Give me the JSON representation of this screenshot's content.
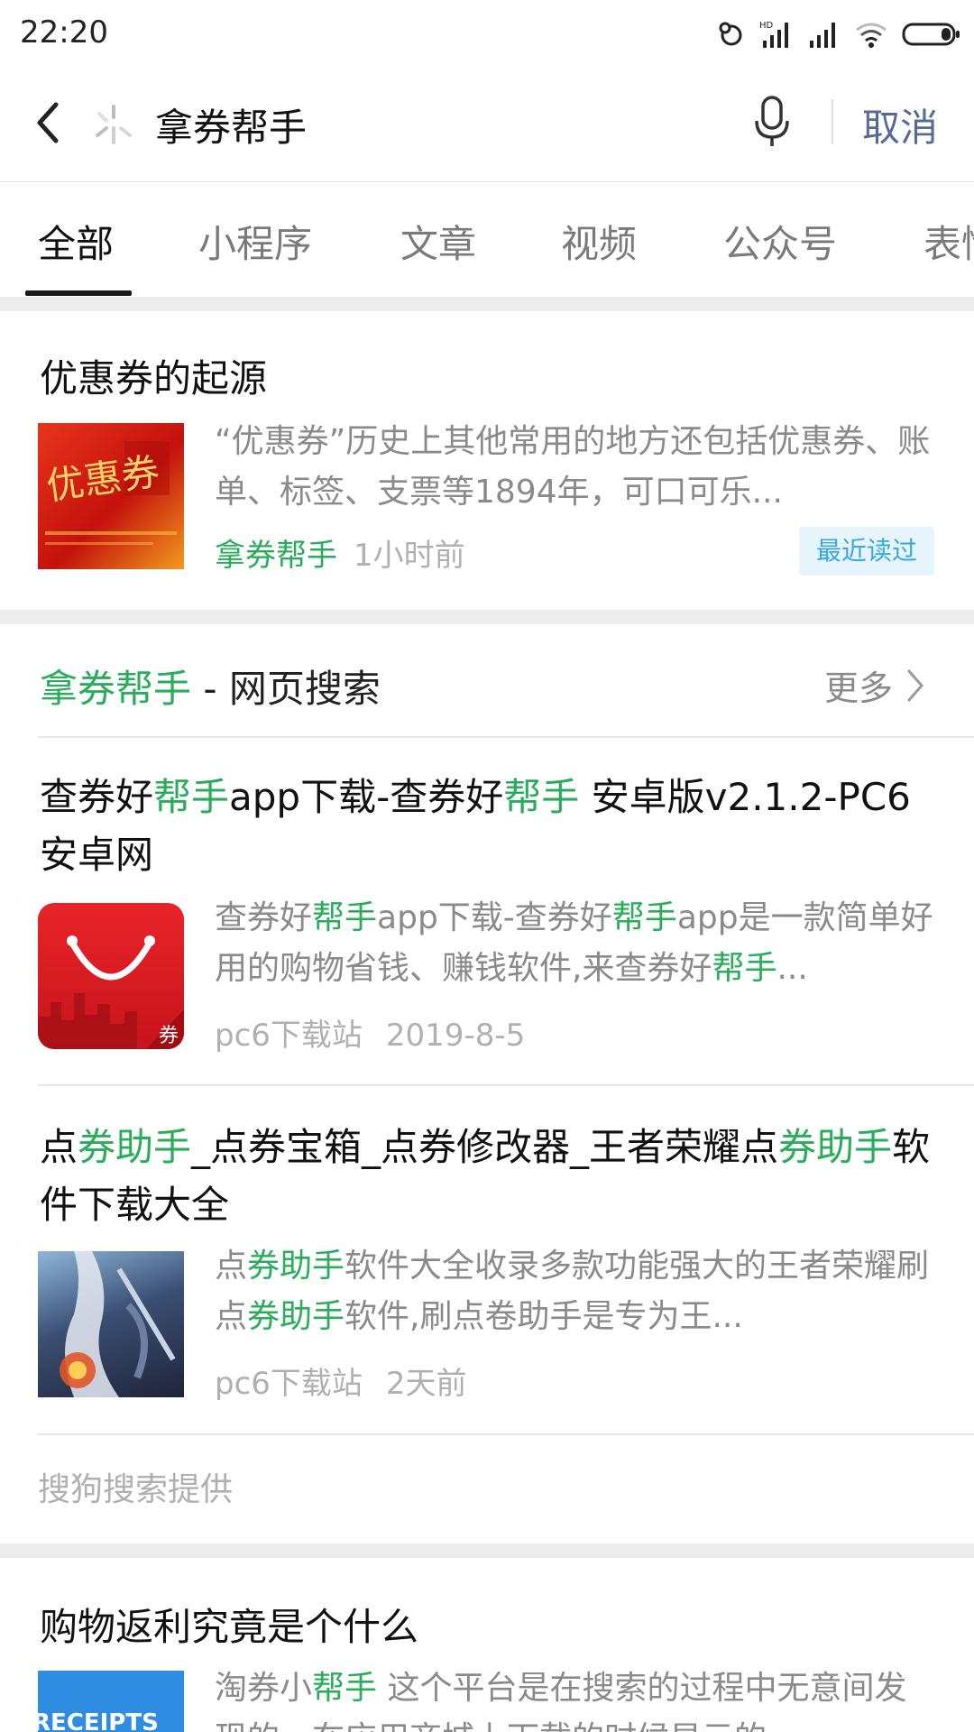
{
  "status_bar": {
    "time": "22:20"
  },
  "search": {
    "query": "拿券帮手",
    "cancel_label": "取消"
  },
  "tabs": [
    {
      "label": "全部",
      "active": true
    },
    {
      "label": "小程序"
    },
    {
      "label": "文章"
    },
    {
      "label": "视频"
    },
    {
      "label": "公众号"
    },
    {
      "label": "表情"
    }
  ],
  "article_card": {
    "title": "优惠券的起源",
    "description": "“优惠券”历史上其他常用的地方还包括优惠券、账单、标签、支票等1894年，可口可乐...",
    "source": "拿券帮手",
    "time": "1小时前",
    "badge": "最近读过",
    "thumb_text": "优惠券"
  },
  "web_search": {
    "keyword": "拿券帮手",
    "heading_suffix": " - 网页搜索",
    "more_label": "更多",
    "results": [
      {
        "title_parts": [
          "查券好",
          "帮手",
          "app下载-查券好",
          "帮手",
          " 安卓版v2.1.2-PC6安卓网"
        ],
        "desc_parts": [
          "查券好",
          "帮手",
          "app下载-查券好",
          "帮手",
          "app是一款简单好用的购物省钱、赚钱软件,来查券好",
          "帮手",
          "..."
        ],
        "source": "pc6下载站",
        "date": "2019-8-5",
        "thumb_badge": "券"
      },
      {
        "title_parts": [
          "点",
          "券助手",
          "_点券宝箱_点券修改器_王者荣耀点",
          "券助手",
          "软件下载大全"
        ],
        "desc_parts": [
          "点",
          "券助手",
          "软件大全收录多款功能强大的王者荣耀刷点",
          "券助手",
          "软件,刷点卷助手是专为王..."
        ],
        "source": "pc6下载站",
        "date": "2天前"
      }
    ],
    "provider": "搜狗搜索提供"
  },
  "article_card_2": {
    "title": "购物返利究竟是个什么",
    "desc_parts": [
      "淘券小",
      "帮手",
      " 这个平台是在搜索的过程中无意间发现的，在应用商城上下载的时候显示的..."
    ],
    "thumb_text": "RECEIPTS"
  },
  "colors": {
    "highlight": "#2aad5b",
    "cancel": "#576b95",
    "badge_text": "#36a9e1"
  }
}
